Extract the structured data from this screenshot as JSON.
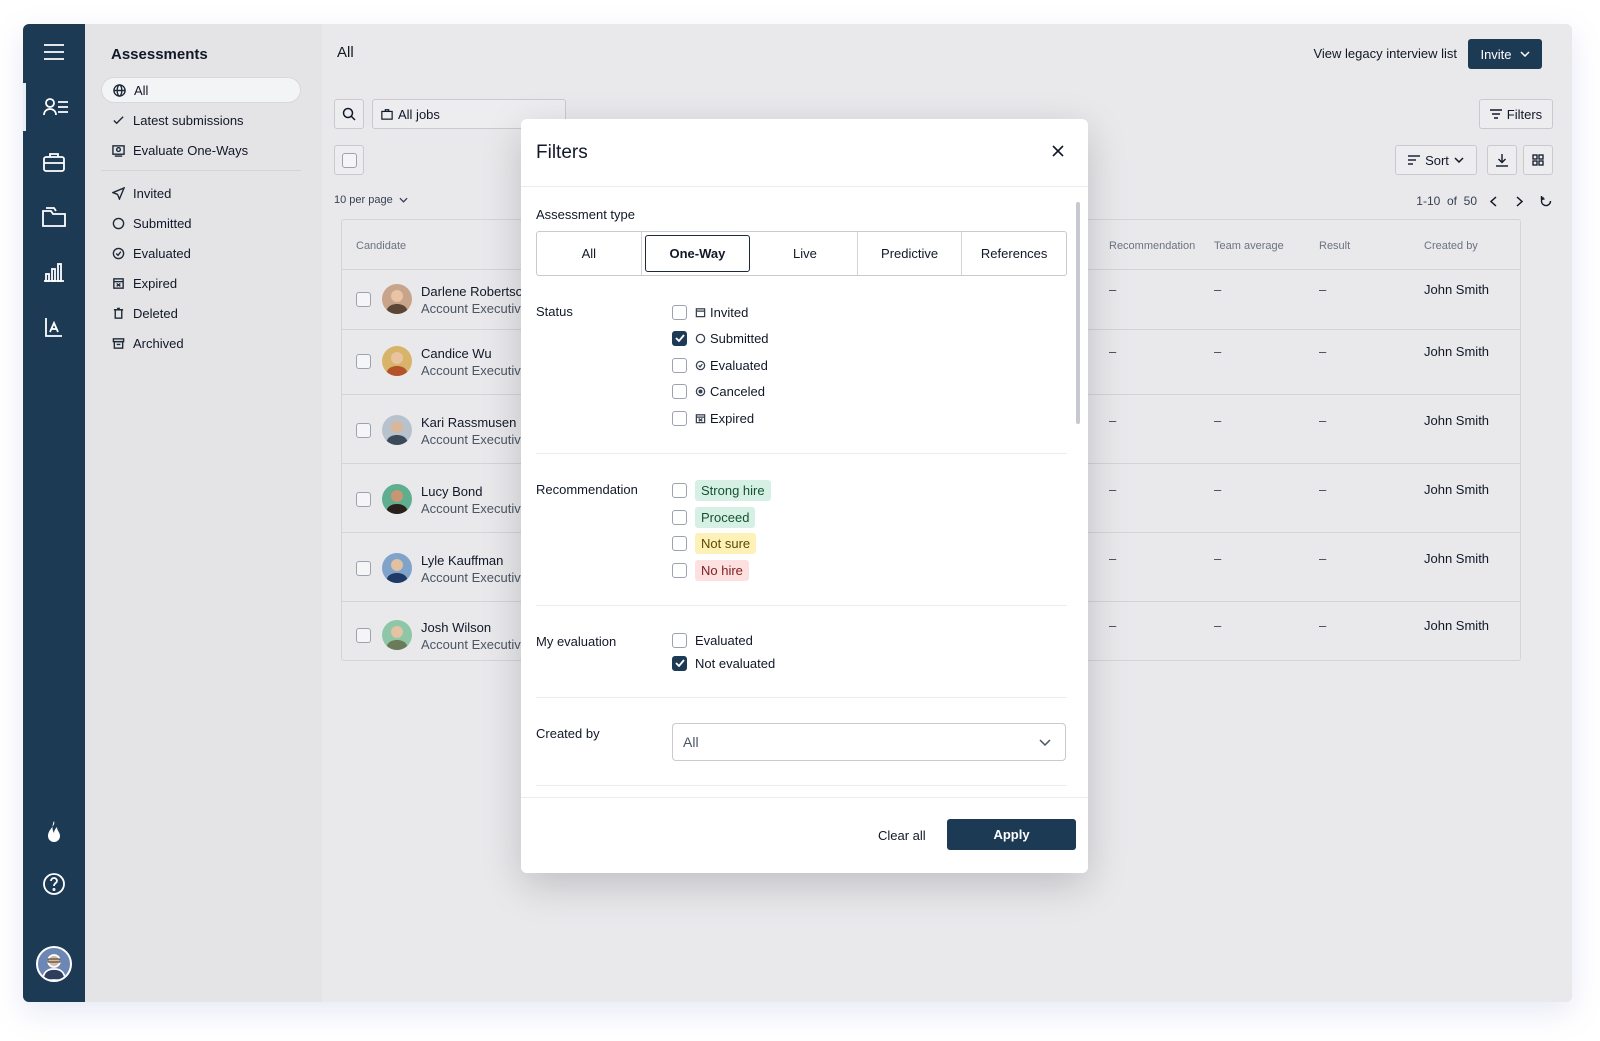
{
  "sidebar": {
    "title": "Assessments",
    "items": [
      {
        "label": "All",
        "icon": "globe-icon"
      },
      {
        "label": "Latest submissions",
        "icon": "check-icon"
      },
      {
        "label": "Evaluate One-Ways",
        "icon": "video-icon"
      },
      {
        "label": "Invited",
        "icon": "send-icon"
      },
      {
        "label": "Submitted",
        "icon": "circle-icon"
      },
      {
        "label": "Evaluated",
        "icon": "check-circle-icon"
      },
      {
        "label": "Expired",
        "icon": "calendar-x-icon"
      },
      {
        "label": "Deleted",
        "icon": "trash-icon"
      },
      {
        "label": "Archived",
        "icon": "archive-icon"
      }
    ]
  },
  "header": {
    "title": "All",
    "legacy_link": "View legacy interview list",
    "invite_label": "Invite"
  },
  "toolbar": {
    "jobs_select": "All jobs",
    "filters_label": "Filters",
    "sort_label": "Sort",
    "per_page": "10 per page",
    "pager_text": "1-10  of  50"
  },
  "table": {
    "headers": {
      "candidate": "Candidate",
      "recommendation": "Recommendation",
      "team_average": "Team average",
      "result": "Result",
      "created_by": "Created by"
    },
    "rows": [
      {
        "name": "Darlene Robertson",
        "role": "Account Executive",
        "rec": "–",
        "team": "–",
        "result": "–",
        "created": "John Smith"
      },
      {
        "name": "Candice Wu",
        "role": "Account Executive",
        "rec": "–",
        "team": "–",
        "result": "–",
        "created": "John Smith"
      },
      {
        "name": "Kari Rassmusen",
        "role": "Account Executive",
        "rec": "–",
        "team": "–",
        "result": "–",
        "created": "John Smith"
      },
      {
        "name": "Lucy Bond",
        "role": "Account Executive",
        "rec": "–",
        "team": "–",
        "result": "–",
        "created": "John Smith"
      },
      {
        "name": "Lyle Kauffman",
        "role": "Account Executive",
        "rec": "–",
        "team": "–",
        "result": "–",
        "created": "John Smith"
      },
      {
        "name": "Josh Wilson",
        "role": "Account Executive",
        "rec": "–",
        "team": "–",
        "result": "–",
        "created": "John Smith"
      }
    ]
  },
  "modal": {
    "title": "Filters",
    "assessment_type_label": "Assessment type",
    "types": [
      "All",
      "One-Way",
      "Live",
      "Predictive",
      "References"
    ],
    "selected_type": "One-Way",
    "status_label": "Status",
    "status_options": [
      {
        "label": "Invited",
        "checked": false
      },
      {
        "label": "Submitted",
        "checked": true
      },
      {
        "label": "Evaluated",
        "checked": false
      },
      {
        "label": "Canceled",
        "checked": false
      },
      {
        "label": "Expired",
        "checked": false
      }
    ],
    "recommendation_label": "Recommendation",
    "recommendation_options": [
      {
        "label": "Strong hire",
        "bg": "#d7f0e6",
        "color": "#14532d"
      },
      {
        "label": "Proceed",
        "bg": "#d7f0e6",
        "color": "#14532d"
      },
      {
        "label": "Not sure",
        "bg": "#fdf1b8",
        "color": "#5b4a00"
      },
      {
        "label": "No hire",
        "bg": "#fde1e1",
        "color": "#7f1d1d"
      }
    ],
    "my_evaluation_label": "My evaluation",
    "my_evaluation_options": [
      {
        "label": "Evaluated",
        "checked": false
      },
      {
        "label": "Not evaluated",
        "checked": true
      }
    ],
    "created_by_label": "Created by",
    "created_by_value": "All",
    "clear_label": "Clear all",
    "apply_label": "Apply"
  }
}
